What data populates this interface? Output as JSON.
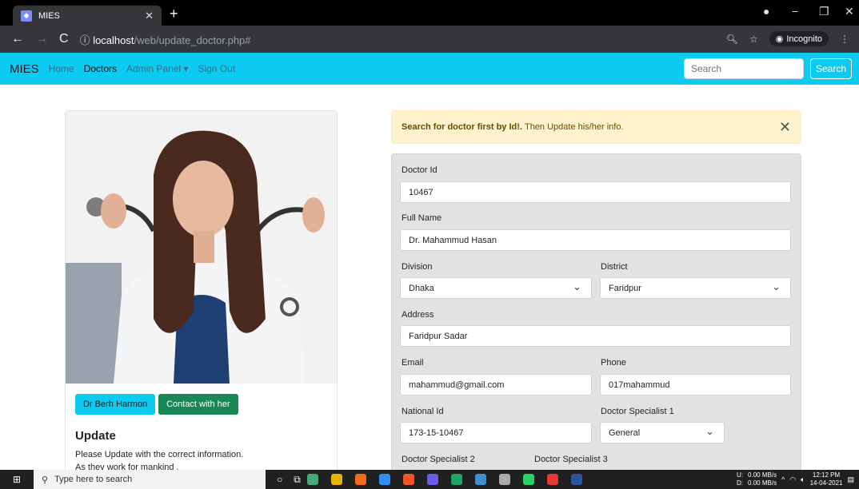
{
  "browser": {
    "tab_title": "MIES",
    "url_host": "localhost",
    "url_path": "/web/update_doctor.php#",
    "incognito_label": "Incognito"
  },
  "navbar": {
    "brand": "MIES",
    "links": [
      "Home",
      "Doctors",
      "Admin Panel ▾",
      "Sign Out"
    ],
    "search_placeholder": "Search",
    "search_button": "Search"
  },
  "card": {
    "doctor_button": "Dr Berh Harmon",
    "contact_button": "Contact with her",
    "title": "Update",
    "text_line1": "Please Update with the correct information.",
    "text_line2": "As they work for mankind ."
  },
  "alert": {
    "bold": "Search for doctor first by Id!.",
    "text": "Then Update his/her info."
  },
  "form": {
    "doctor_id_label": "Doctor Id",
    "doctor_id": "10467",
    "full_name_label": "Full Name",
    "full_name": "Dr. Mahammud Hasan",
    "division_label": "Division",
    "division": "Dhaka",
    "district_label": "District",
    "district": "Faridpur",
    "address_label": "Address",
    "address": "Faridpur Sadar",
    "email_label": "Email",
    "email": "mahammud@gmail.com",
    "phone_label": "Phone",
    "phone": "017mahammud",
    "national_id_label": "National Id",
    "national_id": "173-15-10467",
    "specialist1_label": "Doctor Specialist 1",
    "specialist1": "General",
    "specialist2_label": "Doctor Specialist 2",
    "specialist3_label": "Doctor Specialist 3"
  },
  "taskbar": {
    "search_text": "Type here to search",
    "net_up": "0.00 MB/s",
    "net_down": "0.00 MB/s",
    "drive_u": "U:",
    "drive_d": "D:",
    "time": "12:12 PM",
    "date": "14-04-2021"
  }
}
